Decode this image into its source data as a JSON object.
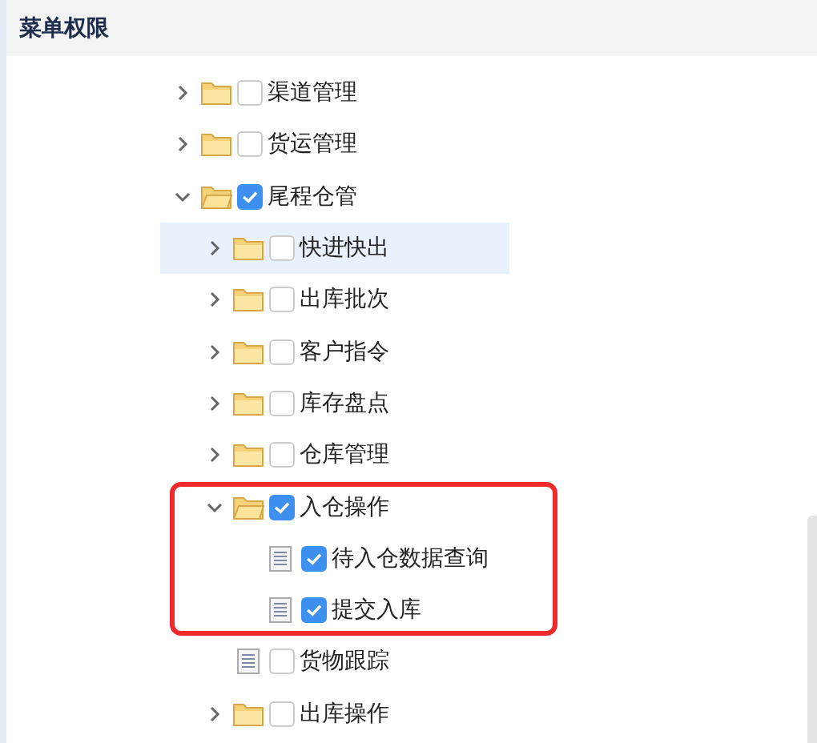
{
  "panel": {
    "title": "菜单权限"
  },
  "tree": [
    {
      "label": "渠道管理",
      "kind": "folder",
      "expanded": false,
      "checked": false,
      "selected": false
    },
    {
      "label": "货运管理",
      "kind": "folder",
      "expanded": false,
      "checked": false,
      "selected": false
    },
    {
      "label": "尾程仓管",
      "kind": "folder",
      "expanded": true,
      "checked": true,
      "selected": false,
      "children": [
        {
          "label": "快进快出",
          "kind": "folder",
          "expanded": false,
          "checked": false,
          "selected": true
        },
        {
          "label": "出库批次",
          "kind": "folder",
          "expanded": false,
          "checked": false,
          "selected": false
        },
        {
          "label": "客户指令",
          "kind": "folder",
          "expanded": false,
          "checked": false,
          "selected": false
        },
        {
          "label": "库存盘点",
          "kind": "folder",
          "expanded": false,
          "checked": false,
          "selected": false
        },
        {
          "label": "仓库管理",
          "kind": "folder",
          "expanded": false,
          "checked": false,
          "selected": false
        },
        {
          "label": "入仓操作",
          "kind": "folder",
          "expanded": true,
          "checked": true,
          "selected": false,
          "highlighted": true,
          "children": [
            {
              "label": "待入仓数据查询",
              "kind": "leaf",
              "checked": true,
              "selected": false
            },
            {
              "label": "提交入库",
              "kind": "leaf",
              "checked": true,
              "selected": false
            }
          ]
        },
        {
          "label": "货物跟踪",
          "kind": "leaf",
          "checked": false,
          "selected": false
        },
        {
          "label": "出库操作",
          "kind": "folder",
          "expanded": false,
          "checked": false,
          "selected": false
        }
      ]
    }
  ]
}
